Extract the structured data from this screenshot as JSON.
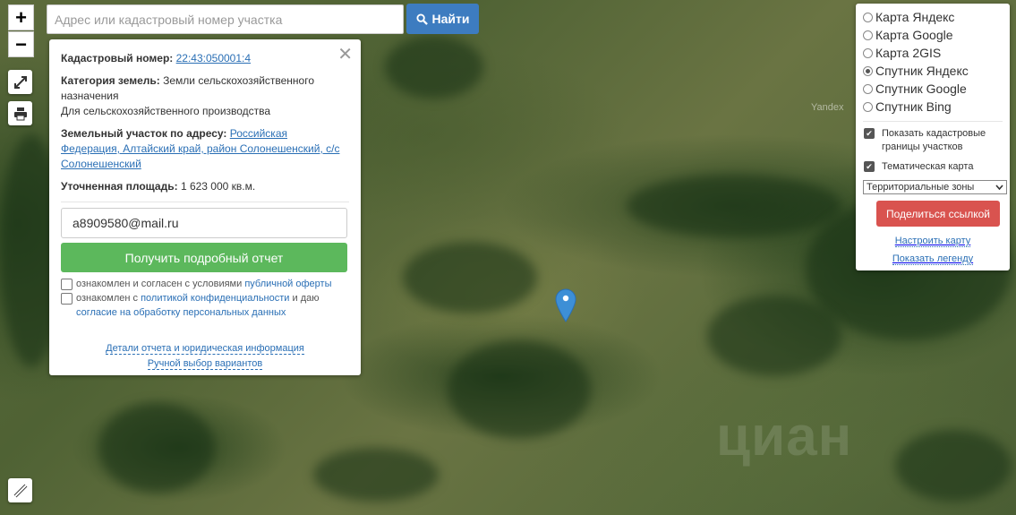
{
  "search": {
    "placeholder": "Адрес или кадастровый номер участка",
    "button_label": "Найти"
  },
  "zoom": {
    "in_label": "+",
    "out_label": "−"
  },
  "info_panel": {
    "cadastral_label": "Кадастровый номер:",
    "cadastral_value": "22:43:050001:4",
    "category_label": "Категория земель:",
    "category_value": "Земли сельскохозяйственного назначения",
    "category_use": "Для сельскохозяйственного производства",
    "address_label": "Земельный участок по адресу:",
    "address_value": "Российская Федерация, Алтайский край, район Солонешенский, с/с Солонешенский",
    "area_label": "Уточненная площадь:",
    "area_value": "1 623 000 кв.м.",
    "email_value": "a8909580@mail.ru",
    "report_button": "Получить подробный отчет",
    "consent1_text": "ознакомлен и согласен с условиями ",
    "consent1_link": "публичной оферты",
    "consent2_text": "ознакомлен с ",
    "consent2_link": "политикой конфиденциальности",
    "consent2_mid": " и даю",
    "consent2_link2": "согласие на обработку персональных данных",
    "link_details": "Детали отчета и юридическая информация",
    "link_manual": "Ручной выбор вариантов"
  },
  "layers": {
    "options": [
      {
        "label": "Карта Яндекс",
        "selected": false
      },
      {
        "label": "Карта Google",
        "selected": false
      },
      {
        "label": "Карта 2GIS",
        "selected": false
      },
      {
        "label": "Спутник Яндекс",
        "selected": true
      },
      {
        "label": "Спутник Google",
        "selected": false
      },
      {
        "label": "Спутник Bing",
        "selected": false
      }
    ],
    "show_borders_label": "Показать кадастровые границы участков",
    "thematic_label": "Тематическая карта",
    "zones_selected": "Территориальные зоны",
    "share_button": "Поделиться ссылкой",
    "configure_link": "Настроить карту",
    "legend_link": "Показать легенду"
  },
  "map": {
    "provider_label": "Yandex",
    "watermark": "циан",
    "marker_color": "#3d8fd6"
  }
}
